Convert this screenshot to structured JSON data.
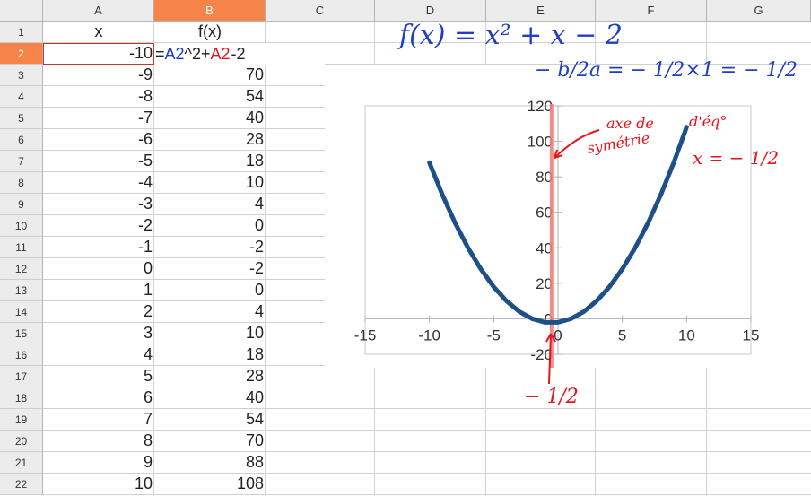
{
  "spreadsheet": {
    "columns": [
      "A",
      "B",
      "C",
      "D",
      "E",
      "F",
      "G"
    ],
    "active_column": "B",
    "active_row": "2",
    "header_row": {
      "a": "x",
      "b": "f(x)"
    },
    "rows": [
      {
        "row": "1",
        "a": "x",
        "b": "f(x)"
      },
      {
        "row": "2",
        "a": "-10",
        "b": ""
      },
      {
        "row": "3",
        "a": "-9",
        "b": "70"
      },
      {
        "row": "4",
        "a": "-8",
        "b": "54"
      },
      {
        "row": "5",
        "a": "-7",
        "b": "40"
      },
      {
        "row": "6",
        "a": "-6",
        "b": "28"
      },
      {
        "row": "7",
        "a": "-5",
        "b": "18"
      },
      {
        "row": "8",
        "a": "-4",
        "b": "10"
      },
      {
        "row": "9",
        "a": "-3",
        "b": "4"
      },
      {
        "row": "10",
        "a": "-2",
        "b": "0"
      },
      {
        "row": "11",
        "a": "-1",
        "b": "-2"
      },
      {
        "row": "12",
        "a": "0",
        "b": "-2"
      },
      {
        "row": "13",
        "a": "1",
        "b": "0"
      },
      {
        "row": "14",
        "a": "2",
        "b": "4"
      },
      {
        "row": "15",
        "a": "3",
        "b": "10"
      },
      {
        "row": "16",
        "a": "4",
        "b": "18"
      },
      {
        "row": "17",
        "a": "5",
        "b": "28"
      },
      {
        "row": "18",
        "a": "6",
        "b": "40"
      },
      {
        "row": "19",
        "a": "7",
        "b": "54"
      },
      {
        "row": "20",
        "a": "8",
        "b": "70"
      },
      {
        "row": "21",
        "a": "9",
        "b": "88"
      },
      {
        "row": "22",
        "a": "10",
        "b": "108"
      }
    ],
    "formula_parts": [
      {
        "text": "=",
        "style": "fx-plain"
      },
      {
        "text": "A2",
        "style": "ref-blue"
      },
      {
        "text": "^2+",
        "style": "fx-plain"
      },
      {
        "text": "A2",
        "style": "ref-red"
      },
      {
        "text": "-2",
        "style": "fx-plain"
      }
    ]
  },
  "annotations": {
    "function": "f(x) = x² + x − 2",
    "vertex_formula": "− b/2a = − 1/2×1 = − 1/2",
    "axis_label_line1": "axe de",
    "axis_label_line2": "symétrie",
    "axis_label_line3": "d'éq°",
    "axis_equation": "x = − 1/2",
    "vertex_x": "− 1/2"
  },
  "colors": {
    "curve": "#1e4f86",
    "axis_of_symmetry": "#f08080",
    "ink_blue": "#1f3fbf",
    "ink_red": "#e5161c",
    "active_header": "#f5834a"
  },
  "chart_data": {
    "type": "scatter",
    "x": [
      -10,
      -9,
      -8,
      -7,
      -6,
      -5,
      -4,
      -3,
      -2,
      -1,
      0,
      1,
      2,
      3,
      4,
      5,
      6,
      7,
      8,
      9,
      10
    ],
    "series": [
      {
        "values": [
          88,
          70,
          54,
          40,
          28,
          18,
          10,
          4,
          0,
          -2,
          -2,
          0,
          4,
          10,
          18,
          28,
          40,
          54,
          70,
          88,
          108
        ]
      }
    ],
    "xlim": [
      -15,
      15
    ],
    "ylim": [
      -20,
      120
    ],
    "xticks": [
      "-15",
      "-10",
      "-5",
      "0",
      "5",
      "10",
      "15"
    ],
    "yticks": [
      "-20",
      "0",
      "20",
      "40",
      "60",
      "80",
      "100",
      "120"
    ],
    "vertical_line_x": -0.5,
    "grid": false
  }
}
